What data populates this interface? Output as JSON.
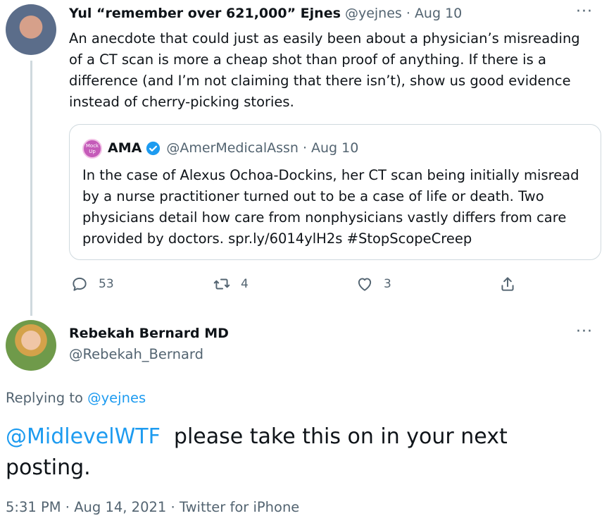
{
  "tweet1": {
    "name": "Yul “remember over 621,000” Ejnes",
    "handle": "@yejnes",
    "sep": "·",
    "date": "Aug 10",
    "more": "···",
    "text": "An anecdote that could just as easily been about a physician’s misreading of a CT scan is more a cheap shot than proof of anything. If there is a difference (and I’m not claiming that there isn’t), show us good evidence instead of cherry-picking stories.",
    "quote": {
      "avatar_text": "Mock Up",
      "name": "AMA",
      "handle": "@AmerMedicalAssn",
      "sep": "·",
      "date": "Aug 10",
      "text": "In the case of Alexus Ochoa-Dockins, her CT scan being initially misread by a nurse practitioner turned out to be a case of life or death. Two physicians detail how care from nonphysicians vastly differs from care provided by doctors. spr.ly/6014ylH2s #StopScopeCreep"
    },
    "actions": {
      "reply_count": "53",
      "retweet_count": "4",
      "like_count": "3"
    }
  },
  "tweet2": {
    "name": "Rebekah Bernard MD",
    "handle": "@Rebekah_Bernard",
    "more": "···",
    "replying_prefix": "Replying to",
    "replying_handle": "@yejnes",
    "mention": "@MidlevelWTF",
    "text_rest": "  please take this on in your next posting.",
    "time": "5:31 PM",
    "sep1": "·",
    "date": "Aug 14, 2021",
    "sep2": "·",
    "source": "Twitter for iPhone"
  },
  "colors": {
    "link": "#1d9bf0",
    "muted": "#536471",
    "border": "#cfd9de"
  },
  "icons": [
    "reply-icon",
    "retweet-icon",
    "like-icon",
    "share-icon",
    "verified-badge-icon",
    "more-icon"
  ]
}
